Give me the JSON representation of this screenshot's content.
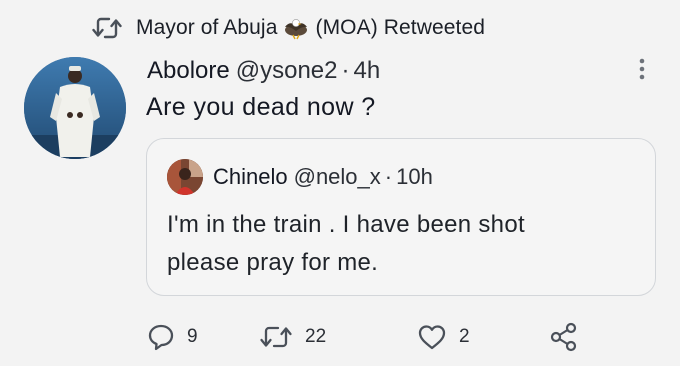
{
  "retweet_banner": {
    "icon": "retweet-icon",
    "account_name": "Mayor of Abuja",
    "account_badge_icon": "eagle-icon",
    "suffix": "(MOA) Retweeted"
  },
  "tweet": {
    "author_name": "Abolore",
    "handle": "@ysone2",
    "separator": "·",
    "time": "4h",
    "text": "Are you dead now ?",
    "more_icon": "more-vertical-icon"
  },
  "quoted_tweet": {
    "author_name": "Chinelo",
    "handle": "@nelo_x",
    "separator": "·",
    "time": "10h",
    "text_line1": "I'm in the train .  I have been shot",
    "text_line2": "please pray for me."
  },
  "actions": {
    "reply_count": "9",
    "retweet_count": "22",
    "like_count": "2"
  },
  "colors": {
    "background": "#f3f3f3",
    "text": "#141823",
    "secondary_text": "#2b2f36",
    "icon": "#4a5059",
    "card_border": "#d3d6da"
  }
}
